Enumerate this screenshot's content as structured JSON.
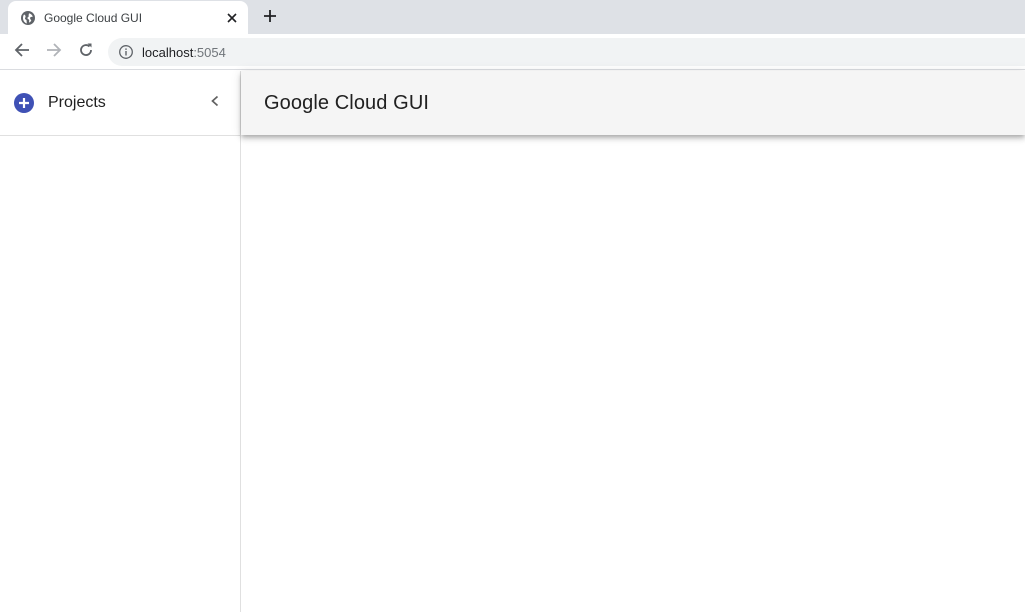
{
  "browser": {
    "tab": {
      "title": "Google Cloud GUI",
      "favicon": "globe-icon"
    },
    "new_tab_icon": "plus-icon",
    "nav": {
      "back_icon": "arrow-left-icon",
      "forward_icon": "arrow-right-icon",
      "reload_icon": "reload-icon"
    },
    "address": {
      "host": "localhost",
      "port": ":5054",
      "security_icon": "info-icon"
    }
  },
  "sidebar": {
    "header_label": "Projects",
    "add_icon": "add-circle-icon",
    "collapse_icon": "chevron-left-icon"
  },
  "main": {
    "title": "Google Cloud GUI"
  },
  "colors": {
    "accent": "#3f51b5",
    "appbar_bg": "#f5f5f5",
    "tabstrip_bg": "#dee1e6",
    "omnibox_bg": "#f1f3f4"
  }
}
